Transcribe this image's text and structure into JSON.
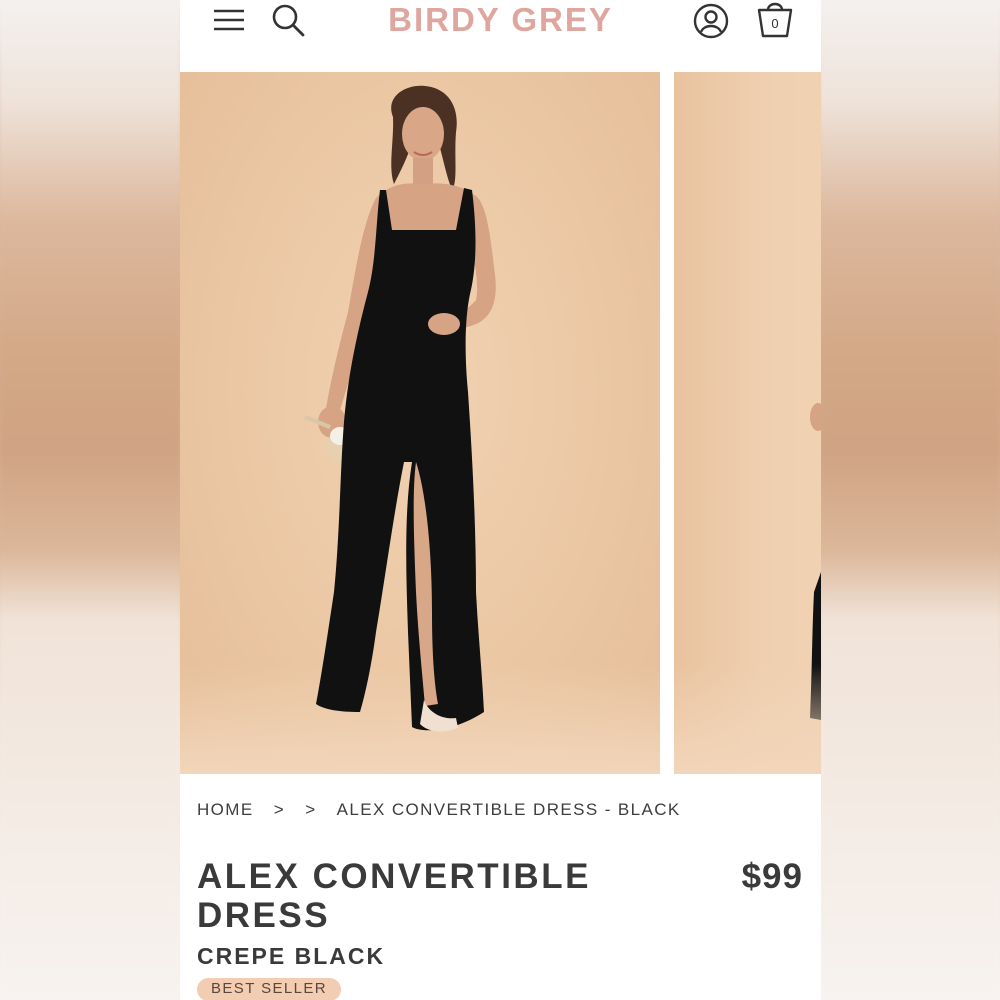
{
  "header": {
    "brand": "BIRDY GREY",
    "menu_icon": "hamburger-menu-icon",
    "search_icon": "search-icon",
    "account_icon": "account-icon",
    "bag_icon": "shopping-bag-icon",
    "bag_count": "0"
  },
  "gallery": {
    "background_color": "#ecc8a6",
    "dress_color": "#111111"
  },
  "breadcrumb": {
    "home": "HOME",
    "sep1": ">",
    "sep2": ">",
    "current": "ALEX CONVERTIBLE DRESS - BLACK"
  },
  "product": {
    "title": "ALEX CONVERTIBLE DRESS",
    "price": "$99",
    "color": "CREPE BLACK",
    "badge": "BEST SELLER"
  },
  "colors": {
    "brand": "#dfa6a0",
    "text": "#3a3a3a",
    "badge_bg": "#f2cdb2"
  }
}
